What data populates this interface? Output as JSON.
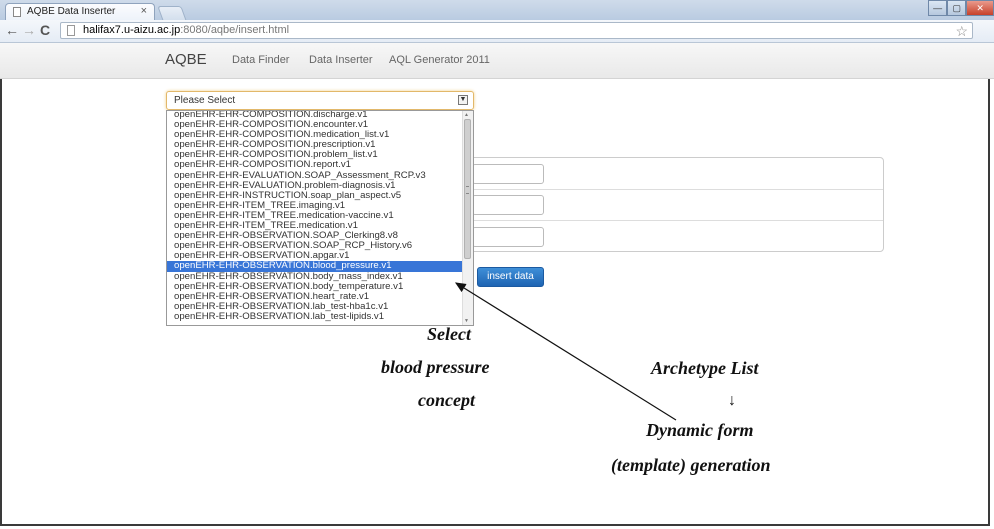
{
  "browser": {
    "tab_title": "AQBE Data Inserter",
    "tab_close": "×",
    "url_host": "halifax7.u-aizu.ac.jp",
    "url_rest": ":8080/aqbe/insert.html"
  },
  "navbar": {
    "brand": "AQBE",
    "links": [
      "Data Finder",
      "Data Inserter",
      "AQL Generator 2011"
    ]
  },
  "select": {
    "value": "Please Select",
    "options": [
      "openEHR-EHR-COMPOSITION.discharge.v1",
      "openEHR-EHR-COMPOSITION.encounter.v1",
      "openEHR-EHR-COMPOSITION.medication_list.v1",
      "openEHR-EHR-COMPOSITION.prescription.v1",
      "openEHR-EHR-COMPOSITION.problem_list.v1",
      "openEHR-EHR-COMPOSITION.report.v1",
      "openEHR-EHR-EVALUATION.SOAP_Assessment_RCP.v3",
      "openEHR-EHR-EVALUATION.problem-diagnosis.v1",
      "openEHR-EHR-INSTRUCTION.soap_plan_aspect.v5",
      "openEHR-EHR-ITEM_TREE.imaging.v1",
      "openEHR-EHR-ITEM_TREE.medication-vaccine.v1",
      "openEHR-EHR-ITEM_TREE.medication.v1",
      "openEHR-EHR-OBSERVATION.SOAP_Clerking8.v8",
      "openEHR-EHR-OBSERVATION.SOAP_RCP_History.v6",
      "openEHR-EHR-OBSERVATION.apgar.v1",
      "openEHR-EHR-OBSERVATION.blood_pressure.v1",
      "openEHR-EHR-OBSERVATION.body_mass_index.v1",
      "openEHR-EHR-OBSERVATION.body_temperature.v1",
      "openEHR-EHR-OBSERVATION.heart_rate.v1",
      "openEHR-EHR-OBSERVATION.lab_test-hba1c.v1",
      "openEHR-EHR-OBSERVATION.lab_test-lipids.v1"
    ],
    "highlighted": "openEHR-EHR-OBSERVATION.blood_pressure.v1"
  },
  "form": {
    "insert_label": "insert data"
  },
  "annotations": {
    "select_line1": "Select",
    "select_line2": "blood pressure",
    "select_line3": "concept",
    "archetype_list": "Archetype List",
    "arrow": "↓",
    "dynamic_line1": "Dynamic form",
    "dynamic_line2": "(template) generation"
  }
}
